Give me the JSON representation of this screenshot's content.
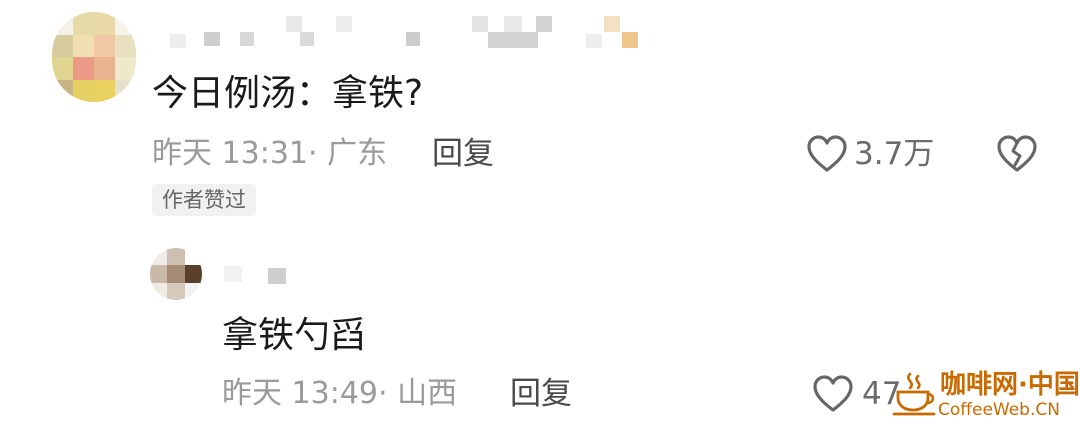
{
  "comment": {
    "content": "今日例汤：拿铁?",
    "meta": "昨天 13:31· 广东",
    "reply_label": "回复",
    "like_count": "3.7万",
    "author_badge": "作者赞过"
  },
  "reply": {
    "content": "拿铁勺舀",
    "meta": "昨天 13:49· 山西",
    "reply_label": "回复",
    "like_count": "47"
  },
  "watermark": {
    "title": "咖啡网·中国",
    "url": "CoffeeWeb.CN"
  },
  "colors": {
    "text_primary": "#1a1a1a",
    "text_meta": "#9a9a9a",
    "watermark": "#c86a00",
    "badge_bg": "#f1f1f1"
  },
  "icons": {
    "like": "heart-outline-icon",
    "dislike": "broken-heart-icon",
    "watermark_logo": "coffee-cup-logo"
  }
}
